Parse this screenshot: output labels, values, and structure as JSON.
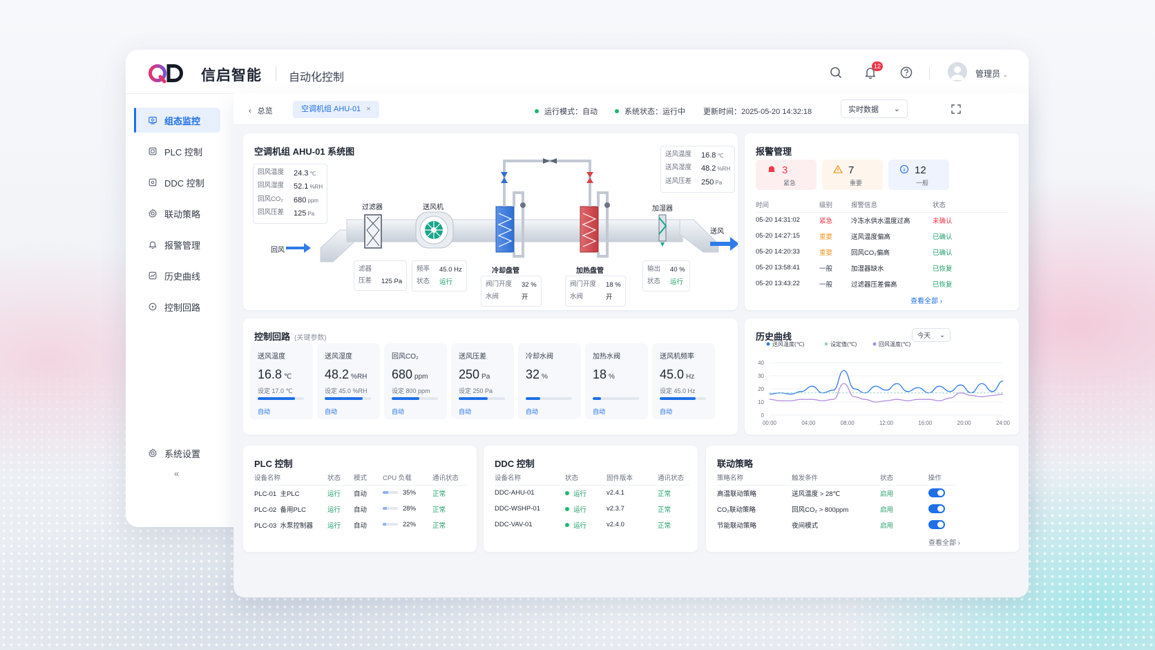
{
  "brand": {
    "name": "信启智能",
    "module": "自动化控制",
    "notifications": "12",
    "user": "管理员"
  },
  "sidebar": {
    "items": [
      {
        "label": "组态监控",
        "icon": "monitor-icon",
        "active": true
      },
      {
        "label": "PLC 控制",
        "icon": "plc-icon"
      },
      {
        "label": "DDC 控制",
        "icon": "ddc-icon"
      },
      {
        "label": "联动策略",
        "icon": "gear-icon"
      },
      {
        "label": "报警管理",
        "icon": "bell-icon"
      },
      {
        "label": "历史曲线",
        "icon": "chart-icon"
      },
      {
        "label": "控制回路",
        "icon": "loop-icon"
      }
    ],
    "settings": "系统设置",
    "collapse": "«"
  },
  "crumb": {
    "back": "总览",
    "tab": "空调机组 AHU-01",
    "close": "×",
    "run_mode": "运行模式：自动",
    "sys_status": "系统状态：运行中",
    "update_time": "更新时间：2025-05-20 14:32:18",
    "data_mode": "实时数据"
  },
  "diagram": {
    "title": "空调机组 AHU-01 系统图",
    "return_params": [
      {
        "k": "回风温度",
        "v": "24.3",
        "u": "℃"
      },
      {
        "k": "回风湿度",
        "v": "52.1",
        "u": "%RH"
      },
      {
        "k": "回风CO₂",
        "v": "680",
        "u": "ppm"
      },
      {
        "k": "回风压差",
        "v": "125",
        "u": "Pa"
      }
    ],
    "supply_params": [
      {
        "k": "送风温度",
        "v": "16.8",
        "u": "℃"
      },
      {
        "k": "送风湿度",
        "v": "48.2",
        "u": "%RH"
      },
      {
        "k": "送风压差",
        "v": "250",
        "u": "Pa"
      }
    ],
    "labels": {
      "return_air": "回风",
      "supply_air": "送风",
      "filter": "过滤器",
      "fan": "送风机",
      "cooling": "冷却盘管",
      "heating": "加热盘管",
      "humidifier": "加湿器"
    },
    "filter_box": [
      {
        "k": "滤器",
        "v": ""
      },
      {
        "k": "压差",
        "v": "125 Pa"
      }
    ],
    "fan_box": [
      {
        "k": "频率",
        "v": "45.0 Hz"
      },
      {
        "k": "状态",
        "v": "运行"
      }
    ],
    "cool_box": [
      {
        "k": "阀门开度",
        "v": "32 %"
      },
      {
        "k": "水阀",
        "v": "开"
      }
    ],
    "heat_box": [
      {
        "k": "阀门开度",
        "v": "18 %"
      },
      {
        "k": "水阀",
        "v": "开"
      }
    ],
    "hum_box": [
      {
        "k": "输出",
        "v": "40 %"
      },
      {
        "k": "状态",
        "v": "运行"
      }
    ]
  },
  "alarms": {
    "title": "报警管理",
    "summary": [
      {
        "n": "3",
        "t": "紧急",
        "color": "#f0394a",
        "bg": "#fdeff0"
      },
      {
        "n": "7",
        "t": "重要",
        "color": "#f39a2b",
        "bg": "#fef6ec"
      },
      {
        "n": "12",
        "t": "一般",
        "color": "#3d7ee9",
        "bg": "#eef3fd"
      }
    ],
    "headers": [
      "时间",
      "级别",
      "报警信息",
      "状态"
    ],
    "rows": [
      {
        "time": "05-20 14:31:02",
        "level": "紧急",
        "msg": "冷冻水供水温度过高",
        "status": "未确认",
        "lc": "#f0394a",
        "sc": "#f0394a"
      },
      {
        "time": "05-20 14:27:15",
        "level": "重要",
        "msg": "送风温度偏高",
        "status": "已确认",
        "lc": "#f39a2b",
        "sc": "#22a06b"
      },
      {
        "time": "05-20 14:20:33",
        "level": "重要",
        "msg": "回风CO₂偏高",
        "status": "已确认",
        "lc": "#f39a2b",
        "sc": "#22a06b"
      },
      {
        "time": "05-20 13:58:41",
        "level": "一般",
        "msg": "加湿器缺水",
        "status": "已恢复",
        "lc": "#3a4150",
        "sc": "#22a06b"
      },
      {
        "time": "05-20 13:43:22",
        "level": "一般",
        "msg": "过滤器压差偏高",
        "status": "已恢复",
        "lc": "#3a4150",
        "sc": "#22a06b"
      }
    ],
    "more": "查看全部 ›"
  },
  "loops": {
    "title": "控制回路",
    "sub": "(关键参数)",
    "items": [
      {
        "name": "送风温度",
        "value": "16.8",
        "unit": "℃",
        "set": "设定  17.0 ℃",
        "pct": 0.8,
        "mode": "自动"
      },
      {
        "name": "送风湿度",
        "value": "48.2",
        "unit": "%RH",
        "set": "设定  45.0 %RH",
        "pct": 0.82,
        "mode": "自动"
      },
      {
        "name": "回风CO₂",
        "value": "680",
        "unit": "ppm",
        "set": "设定  800 ppm",
        "pct": 0.6,
        "mode": "自动"
      },
      {
        "name": "送风压差",
        "value": "250",
        "unit": "Pa",
        "set": "设定  250 Pa",
        "pct": 0.62,
        "mode": "自动"
      },
      {
        "name": "冷却水阀",
        "value": "32",
        "unit": "%",
        "set": "",
        "pct": 0.32,
        "mode": "自动"
      },
      {
        "name": "加热水阀",
        "value": "18",
        "unit": "%",
        "set": "",
        "pct": 0.18,
        "mode": "自动"
      },
      {
        "name": "送风机频率",
        "value": "45.0",
        "unit": "Hz",
        "set": "设定  45.0 Hz",
        "pct": 0.78,
        "mode": "自动"
      }
    ]
  },
  "history": {
    "title": "历史曲线",
    "range": "今天"
  },
  "chart_data": {
    "type": "line",
    "x": [
      "00:00",
      "04:00",
      "08:00",
      "12:00",
      "16:00",
      "20:00",
      "24:00"
    ],
    "ylim": [
      0,
      40
    ],
    "yticks": [
      0,
      10,
      20,
      30,
      40
    ],
    "legend": "top",
    "series": [
      {
        "name": "送风温度(℃)",
        "color": "#2f7be8",
        "values": [
          16,
          17,
          16,
          18,
          22,
          17,
          19,
          34,
          20,
          17,
          22,
          19,
          24,
          18,
          21,
          17,
          22,
          18,
          23,
          17,
          24,
          18,
          26
        ]
      },
      {
        "name": "设定值(℃)",
        "color": "#9ed3c8",
        "values": [
          17,
          17,
          17,
          17,
          17,
          17,
          17,
          17,
          17,
          17,
          17,
          17,
          17,
          17,
          17,
          17,
          17,
          17,
          17,
          17,
          17,
          17,
          17
        ]
      },
      {
        "name": "回风温度(℃)",
        "color": "#b28ddf",
        "values": [
          12,
          11,
          11,
          12,
          12,
          11,
          12,
          24,
          14,
          12,
          10,
          11,
          12,
          11,
          12,
          12,
          11,
          13,
          17,
          15,
          14,
          15,
          16
        ]
      }
    ]
  },
  "plc": {
    "title": "PLC 控制",
    "headers": [
      "设备名称",
      "状态",
      "模式",
      "CPU 负载",
      "通讯状态"
    ],
    "rows": [
      {
        "id": "PLC-01",
        "name": "主PLC",
        "status": "运行",
        "mode": "自动",
        "cpu": "35%",
        "cpu_v": 0.35,
        "comm": "正常"
      },
      {
        "id": "PLC-02",
        "name": "备用PLC",
        "status": "运行",
        "mode": "自动",
        "cpu": "28%",
        "cpu_v": 0.28,
        "comm": "正常"
      },
      {
        "id": "PLC-03",
        "name": "水泵控制器",
        "status": "运行",
        "mode": "自动",
        "cpu": "22%",
        "cpu_v": 0.22,
        "comm": "正常"
      }
    ]
  },
  "ddc": {
    "title": "DDC 控制",
    "headers": [
      "设备名称",
      "状态",
      "固件版本",
      "通讯状态"
    ],
    "rows": [
      {
        "name": "DDC-AHU-01",
        "status": "运行",
        "fw": "v2.4.1",
        "comm": "正常"
      },
      {
        "name": "DDC-WSHP-01",
        "status": "运行",
        "fw": "v2.3.7",
        "comm": "正常"
      },
      {
        "name": "DDC-VAV-01",
        "status": "运行",
        "fw": "v2.4.0",
        "comm": "正常"
      }
    ]
  },
  "strategy": {
    "title": "联动策略",
    "headers": [
      "策略名称",
      "触发条件",
      "状态",
      "操作"
    ],
    "rows": [
      {
        "name": "高温联动策略",
        "cond": "送风温度 > 28℃",
        "status": "启用"
      },
      {
        "name": "CO₂联动策略",
        "cond": "回风CO₂ > 800ppm",
        "status": "启用"
      },
      {
        "name": "节能联动策略",
        "cond": "夜间模式",
        "status": "启用"
      }
    ],
    "more": "查看全部 ›"
  }
}
